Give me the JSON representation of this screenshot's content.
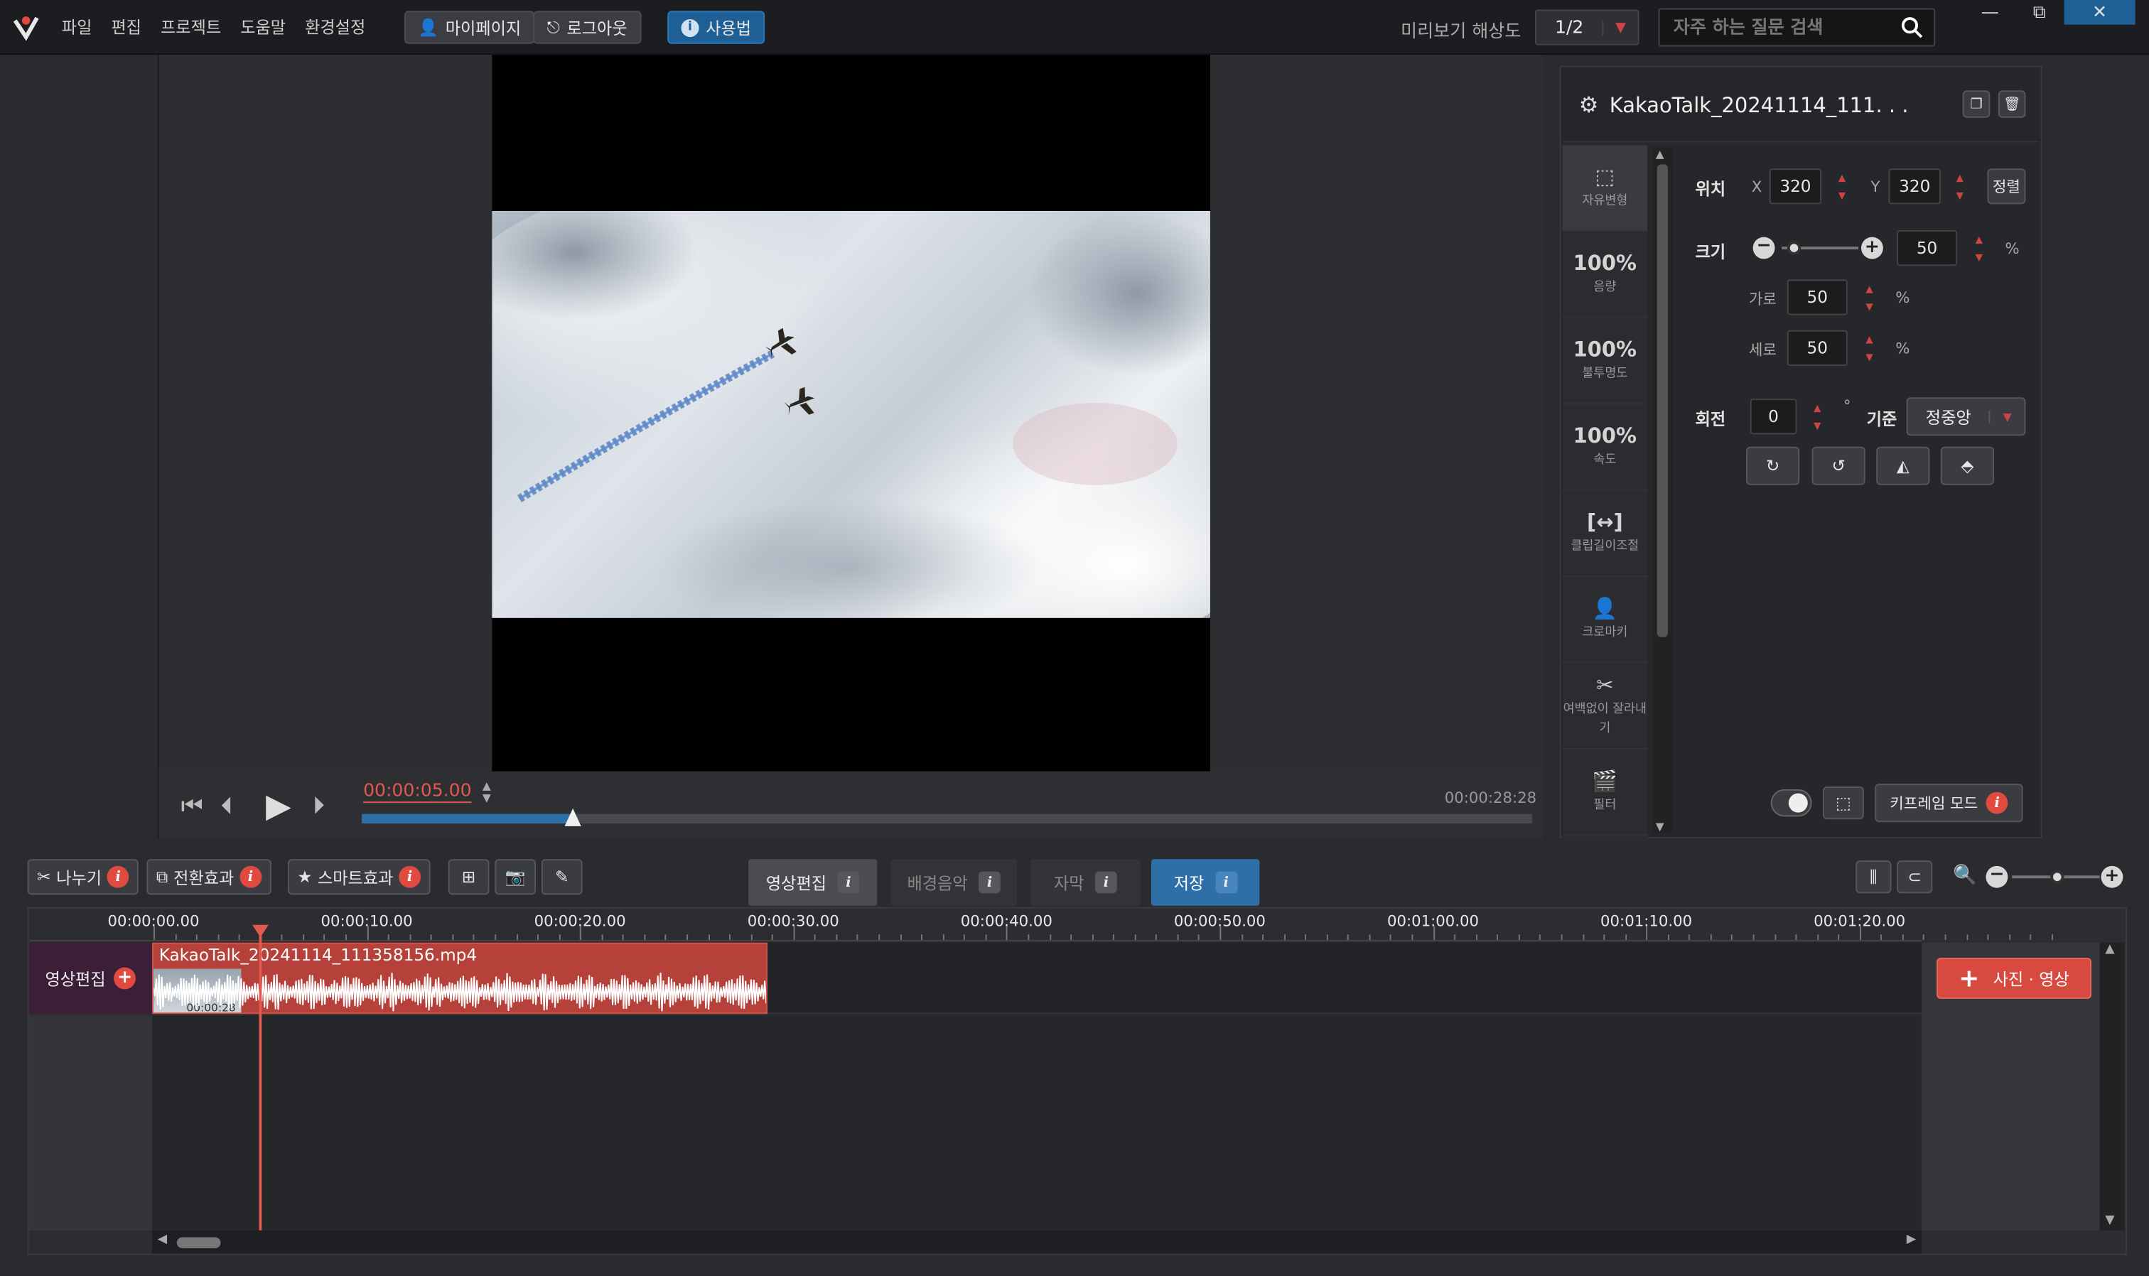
{
  "menu": [
    "파일",
    "편집",
    "프로젝트",
    "도움말",
    "환경설정"
  ],
  "top_buttons": {
    "mypage": "마이페이지",
    "logout": "로그아웃",
    "howto": "사용법"
  },
  "preview_resolution": {
    "label": "미리보기 해상도",
    "value": "1/2"
  },
  "faq_search": {
    "placeholder": "자주 하는 질문 검색"
  },
  "window_controls": {
    "minimize": "—",
    "restore": "⧉",
    "close": "✕"
  },
  "player": {
    "current_time": "00:00:05.00",
    "total_time": "00:00:28:28",
    "progress": 0.18
  },
  "props": {
    "title": "KakaoTalk_20241114_111. . .",
    "side_tabs": [
      {
        "big": "⬚",
        "small": "자유변형"
      },
      {
        "big": "100%",
        "small": "음량"
      },
      {
        "big": "100%",
        "small": "불투명도"
      },
      {
        "big": "100%",
        "small": "속도"
      },
      {
        "big": "[↔]",
        "small": "클립길이조절"
      },
      {
        "big": "👤",
        "small": "크로마키"
      },
      {
        "big": "✂",
        "small": "여백없이 잘라내기"
      },
      {
        "big": "🎬",
        "small": "필터"
      }
    ],
    "position": {
      "label": "위치",
      "x_label": "X",
      "x": "320",
      "y_label": "Y",
      "y": "320",
      "align": "정렬"
    },
    "size": {
      "label": "크기",
      "value": "50",
      "unit": "%",
      "slider": 0.1,
      "width_label": "가로",
      "width": "50",
      "height_label": "세로",
      "height": "50"
    },
    "rotation": {
      "label": "회전",
      "value": "0",
      "unit": "°",
      "anchor_label": "기준",
      "anchor": "정중앙"
    },
    "keyframe": "키프레임 모드"
  },
  "tools": {
    "split": "나누기",
    "transition": "전환효과",
    "smart": "스마트효과"
  },
  "tabs": [
    {
      "label": "영상편집",
      "state": "active"
    },
    {
      "label": "배경음악",
      "state": "dim"
    },
    {
      "label": "자막",
      "state": "dim"
    },
    {
      "label": "저장",
      "state": "save"
    }
  ],
  "timeline": {
    "ruler": [
      "00:00:00.00",
      "00:00:10.00",
      "00:00:20.00",
      "00:00:30.00",
      "00:00:40.00",
      "00:00:50.00",
      "00:01:00.00",
      "00:01:10.00",
      "00:01:20.00"
    ],
    "track_label": "영상편집",
    "clip_name": "KakaoTalk_20241114_111358156.mp4",
    "clip_thumb_time": "00:00:28",
    "add_media": "사진 · 영상"
  },
  "colors": {
    "accent_red": "#e04a3f",
    "clip": "#b6403a",
    "save_blue": "#2f6fa8"
  }
}
